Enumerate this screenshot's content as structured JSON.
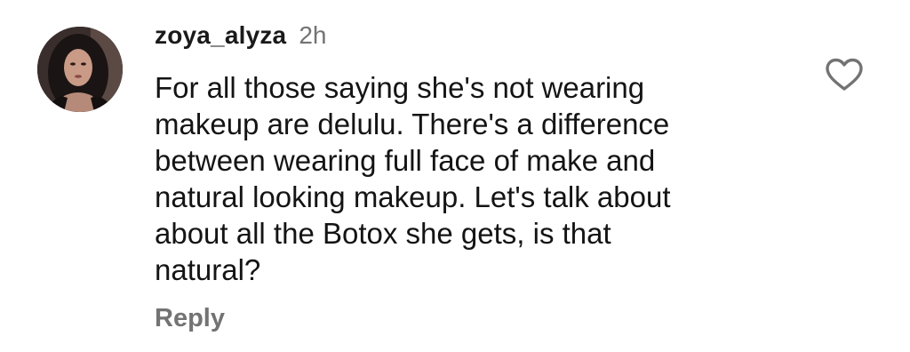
{
  "comment": {
    "username": "zoya_alyza",
    "time": "2h",
    "text": "For all those saying she's not wearing\nmakeup are delulu. There's a difference\nbetween wearing full face of make and\nnatural looking makeup. Let's talk about\nabout all the Botox she gets, is that\nnatural?",
    "reply_label": "Reply",
    "like_icon": "heart-outline-icon"
  },
  "colors": {
    "text": "#141414",
    "secondary": "#737373",
    "background": "#ffffff"
  }
}
